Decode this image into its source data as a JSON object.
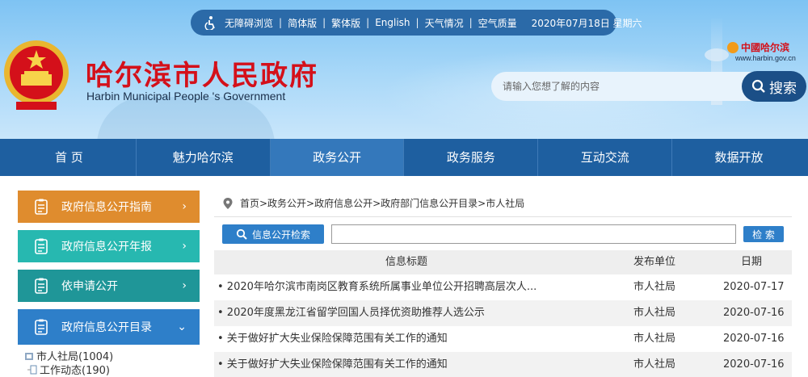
{
  "topbar": {
    "items": [
      "无障碍浏览",
      "简体版",
      "繁体版",
      "English",
      "天气情况",
      "空气质量"
    ],
    "separator": "|",
    "date": "2020年07月18日 星期六"
  },
  "site": {
    "title": "哈尔滨市人民政府",
    "subtitle": "Harbin Municipal People 's Government"
  },
  "city_logo": {
    "name": "中國哈尔滨",
    "url": "www.harbin.gov.cn"
  },
  "search": {
    "placeholder": "请输入您想了解的内容",
    "button_label": "搜索"
  },
  "nav": {
    "items": [
      "首 页",
      "魅力哈尔滨",
      "政务公开",
      "政务服务",
      "互动交流",
      "数据开放"
    ],
    "active_index": 2
  },
  "sidebar": {
    "buttons": [
      {
        "label": "政府信息公开指南",
        "arrow": "›",
        "color": "#df8c2e"
      },
      {
        "label": "政府信息公开年报",
        "arrow": "›",
        "color": "#27b8b0"
      },
      {
        "label": "依申请公开",
        "arrow": "›",
        "color": "#1f9698"
      },
      {
        "label": "政府信息公开目录",
        "arrow": "⌄",
        "color": "#2e7fc9"
      }
    ],
    "tree": [
      {
        "label": "市人社局(1004)"
      },
      {
        "label": "工作动态(190)"
      }
    ]
  },
  "breadcrumb": "首页>政务公开>政府信息公开>政府部门信息公开目录>市人社局",
  "info_search": {
    "button_label": "信息公开检索",
    "query_label": "检 索",
    "value": ""
  },
  "table": {
    "headers": {
      "title": "信息标题",
      "unit": "发布单位",
      "date": "日期"
    },
    "rows": [
      {
        "title": "• 2020年哈尔滨市南岗区教育系统所属事业单位公开招聘高层次人...",
        "unit": "市人社局",
        "date": "2020-07-17"
      },
      {
        "title": "• 2020年度黑龙江省留学回国人员择优资助推荐人选公示",
        "unit": "市人社局",
        "date": "2020-07-16"
      },
      {
        "title": "• 关于做好扩大失业保险保障范围有关工作的通知",
        "unit": "市人社局",
        "date": "2020-07-16"
      },
      {
        "title": "• 关于做好扩大失业保险保障范围有关工作的通知",
        "unit": "市人社局",
        "date": "2020-07-16"
      }
    ]
  },
  "colors": {
    "title_red": "#d4101a",
    "nav_blue": "#1e5fa0",
    "accent_blue": "#2e7fc9"
  }
}
